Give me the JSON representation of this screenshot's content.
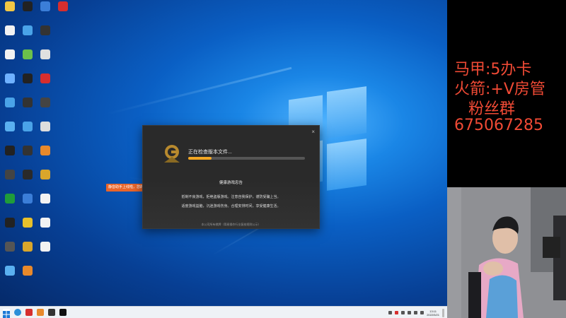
{
  "desktop": {
    "icon_rows": [
      [
        {
          "label": "",
          "color": "#f2c744"
        },
        {
          "label": "",
          "color": "#222"
        },
        {
          "label": "",
          "color": "#3b7ed8"
        },
        {
          "label": "",
          "color": "#d62e2e"
        }
      ],
      [
        {
          "label": "",
          "color": "#f2f2f2"
        },
        {
          "label": "",
          "color": "#4aa3e8"
        },
        {
          "label": "",
          "color": "#333"
        }
      ],
      [
        {
          "label": "",
          "color": "#f2f2f2"
        },
        {
          "label": "",
          "color": "#6bc04b"
        },
        {
          "label": "",
          "color": "#e0e0e0"
        }
      ],
      [
        {
          "label": "",
          "color": "#6fb1ff"
        },
        {
          "label": "",
          "color": "#222"
        },
        {
          "label": "",
          "color": "#d62e2e"
        }
      ],
      [
        {
          "label": "",
          "color": "#4aa3e8"
        },
        {
          "label": "",
          "color": "#333"
        },
        {
          "label": "",
          "color": "#444"
        }
      ],
      [
        {
          "label": "",
          "color": "#5ab0f0"
        },
        {
          "label": "",
          "color": "#4aa3e8"
        },
        {
          "label": "",
          "color": "#ddd"
        }
      ],
      [
        {
          "label": "",
          "color": "#222"
        },
        {
          "label": "",
          "color": "#333"
        },
        {
          "label": "",
          "color": "#e8892b"
        }
      ],
      [
        {
          "label": "",
          "color": "#444"
        },
        {
          "label": "",
          "color": "#2a2a2a"
        },
        {
          "label": "",
          "color": "#d9a62b"
        }
      ],
      [
        {
          "label": "",
          "color": "#1f9c3a"
        },
        {
          "label": "",
          "color": "#3b7ed8"
        },
        {
          "label": "",
          "color": "#f2f2f2"
        }
      ],
      [
        {
          "label": "",
          "color": "#222"
        },
        {
          "label": "",
          "color": "#e8c02b"
        },
        {
          "label": "",
          "color": "#f2f2f2"
        }
      ],
      [
        {
          "label": "",
          "color": "#555"
        },
        {
          "label": "",
          "color": "#d9a62b"
        },
        {
          "label": "",
          "color": "#f2f2f2"
        }
      ],
      [
        {
          "label": "",
          "color": "#5ab0f0"
        },
        {
          "label": "",
          "color": "#e8892b"
        }
      ]
    ],
    "notice_text": "静音助手上线啦，您的"
  },
  "launcher": {
    "close_glyph": "×",
    "status": "正在检查版本文件...",
    "progress_percent": 20,
    "health_title": "健康游戏忠告",
    "health_lines": [
      "抵制不良游戏，拒绝盗版游戏。注意自我保护，谨防受骗上当。",
      "适度游戏益脑，沉迷游戏伤身。合理安排时间，享受健康生活。"
    ],
    "approval": "本公司所有棋牌（简易操作行业复核规则公示）",
    "accent": "#f2a623"
  },
  "taskbar": {
    "apps": [
      "start",
      "edge",
      "red-app",
      "orange-app",
      "dark-app",
      "black-app"
    ],
    "time": "13:11",
    "date": "2022/5/21"
  },
  "overlay": {
    "line1": "马甲:5办卡",
    "line2": "火箭:+V房管",
    "line3": "粉丝群",
    "number": "675067285",
    "text_color": "#f04a35"
  }
}
